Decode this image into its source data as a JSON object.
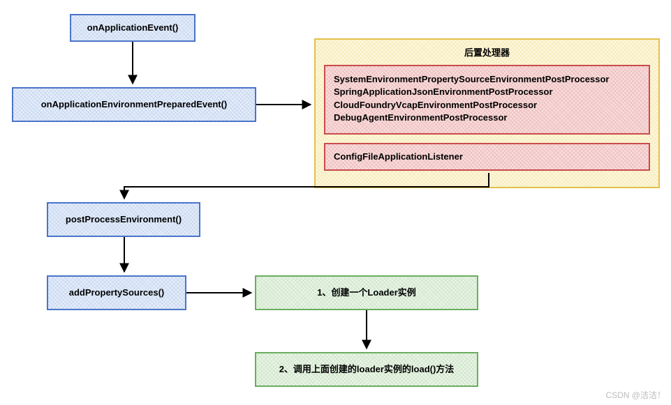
{
  "nodes": {
    "onApplicationEvent": "onApplicationEvent()",
    "onApplicationEnvironmentPreparedEvent": "onApplicationEnvironmentPreparedEvent()",
    "postProcessEnvironment": "postProcessEnvironment()",
    "addPropertySources": "addPropertySources()",
    "createLoader": "1、创建一个Loader实例",
    "callLoad": "2、调用上面创建的loader实例的load()方法"
  },
  "postProcessorGroup": {
    "title": "后置处理器",
    "items": [
      "SystemEnvironmentPropertySourceEnvironmentPostProcessor",
      "SpringApplicationJsonEnvironmentPostProcessor",
      "CloudFoundryVcapEnvironmentPostProcessor",
      "DebugAgentEnvironmentPostProcessor"
    ],
    "listener": "ConfigFileApplicationListener"
  },
  "watermark": "CSDN @洁洁！"
}
